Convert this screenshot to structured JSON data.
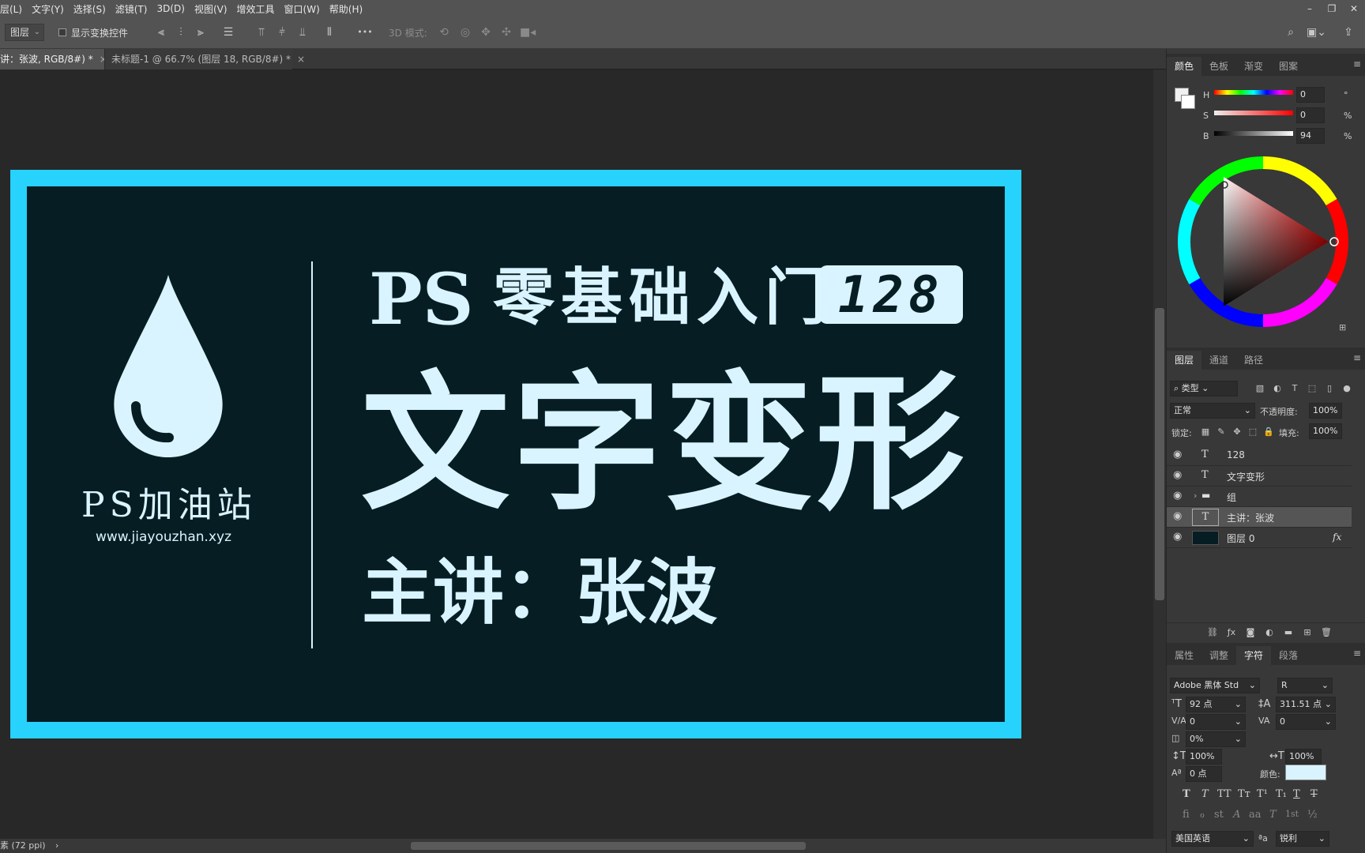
{
  "menubar": {
    "items": [
      "层(L)",
      "文字(Y)",
      "选择(S)",
      "滤镜(T)",
      "3D(D)",
      "视图(V)",
      "增效工具",
      "窗口(W)",
      "帮助(H)"
    ],
    "window_controls": [
      "–",
      "❐",
      "✕"
    ]
  },
  "options": {
    "auto_select_value": "图层",
    "show_transform_label": "显示变换控件",
    "more": "•••",
    "mode_3d_label": "3D 模式:"
  },
  "tabs": [
    {
      "label": "讲：张波, RGB/8#) *",
      "close": "×",
      "active": true
    },
    {
      "label": "未标题-1 @ 66.7% (图层 18, RGB/8#) *",
      "close": "×",
      "active": false
    }
  ],
  "status": {
    "text": "素 (72 ppi)",
    "arrow": "›"
  },
  "artwork": {
    "logo_name": "PS加油站",
    "url": "www.jiayouzhan.xyz",
    "series_prefix": "PS",
    "series_title": "零基础入门",
    "episode": "128",
    "main_title": "文字变形",
    "presenter": "主讲：张波",
    "colors": {
      "border": "#27d2fd",
      "background": "#071d24",
      "text": "#d9f4ff"
    }
  },
  "color_panel": {
    "tabs": [
      "颜色",
      "色板",
      "渐变",
      "图案"
    ],
    "h_label": "H",
    "h_value": "0",
    "h_unit": "°",
    "s_label": "S",
    "s_value": "0",
    "s_unit": "%",
    "b_label": "B",
    "b_value": "94",
    "b_unit": "%"
  },
  "layers_panel": {
    "tabs": [
      "图层",
      "通道",
      "路径"
    ],
    "filter_kind": "类型",
    "blend_mode": "正常",
    "opacity_label": "不透明度:",
    "opacity_value": "100%",
    "lock_label": "锁定:",
    "fill_label": "填充:",
    "fill_value": "100%",
    "layers": [
      {
        "type": "T",
        "name": "128",
        "selected": false
      },
      {
        "type": "T",
        "name": "文字变形",
        "selected": false
      },
      {
        "type": "group",
        "name": "组",
        "selected": false
      },
      {
        "type": "T",
        "name": "主讲：张波",
        "selected": true
      },
      {
        "type": "image",
        "name": "图层 0",
        "selected": false,
        "fx": "fx"
      }
    ]
  },
  "character_panel": {
    "tabs": [
      "属性",
      "调整",
      "字符",
      "段落"
    ],
    "font_family": "Adobe 黑体 Std",
    "font_style": "R",
    "font_size": "92 点",
    "leading": "311.51 点",
    "kerning": "0",
    "tracking": "0",
    "tsume": "0%",
    "vertical_scale": "100%",
    "horizontal_scale": "100%",
    "baseline_shift": "0 点",
    "color_label": "颜色:",
    "color_swatch": "#d9f4ff",
    "style_buttons": [
      "T",
      "T",
      "TT",
      "Tт",
      "T¹",
      "T₁",
      "T",
      "T"
    ],
    "opentype_buttons": [
      "fi",
      "ℴ",
      "st",
      "A",
      "aa",
      "T",
      "1st",
      "½"
    ],
    "language": "美国英语",
    "aa_label": "ªa",
    "antialias": "锐利"
  }
}
